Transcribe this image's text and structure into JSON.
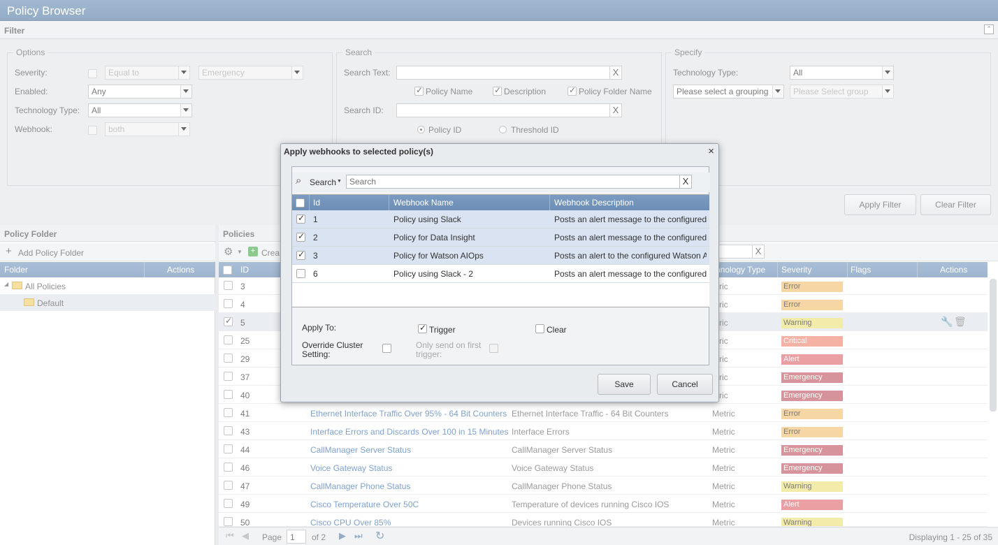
{
  "app": {
    "title": "Policy Browser"
  },
  "filter": {
    "title": "Filter",
    "options": {
      "legend": "Options",
      "severity_label": "Severity:",
      "severity_op": "Equal to",
      "severity_value": "Emergency",
      "enabled_label": "Enabled:",
      "enabled_value": "Any",
      "tech_label": "Technology Type:",
      "tech_value": "All",
      "webhook_label": "Webhook:",
      "webhook_value": "both"
    },
    "search": {
      "legend": "Search",
      "text_label": "Search Text:",
      "policy_name": "Policy Name",
      "description": "Description",
      "policy_folder_name": "Policy Folder Name",
      "id_label": "Search ID:",
      "policy_id": "Policy ID",
      "threshold_id": "Threshold ID",
      "clear_glyph": "X"
    },
    "specify": {
      "legend": "Specify",
      "tech_label": "Technology Type:",
      "tech_value": "All",
      "grouping": "Please select a grouping",
      "group": "Please Select group"
    },
    "apply_button": "Apply Filter",
    "clear_button": "Clear Filter"
  },
  "folder_panel": {
    "title": "Policy Folder",
    "add_label": "Add Policy Folder",
    "col_folder": "Folder",
    "col_actions": "Actions",
    "tree": [
      {
        "label": "All Policies"
      },
      {
        "label": "Default"
      }
    ]
  },
  "policies": {
    "title": "Policies",
    "create_label": "Crea",
    "columns": {
      "id": "ID",
      "tech": "chnology Type",
      "severity": "Severity",
      "flags": "Flags",
      "actions": "Actions"
    },
    "rows": [
      {
        "id": "3",
        "name": "",
        "desc": "",
        "tech": "etric",
        "severity": "Error",
        "checked": false
      },
      {
        "id": "4",
        "name": "",
        "desc": "",
        "tech": "etric",
        "severity": "Error",
        "checked": false
      },
      {
        "id": "5",
        "name": "",
        "desc": "",
        "tech": "etric",
        "severity": "Warning",
        "checked": true
      },
      {
        "id": "25",
        "name": "",
        "desc": "",
        "tech": "etric",
        "severity": "Critical",
        "checked": false
      },
      {
        "id": "29",
        "name": "",
        "desc": "",
        "tech": "etric",
        "severity": "Alert",
        "checked": false
      },
      {
        "id": "37",
        "name": "",
        "desc": "",
        "tech": "etric",
        "severity": "Emergency",
        "checked": false
      },
      {
        "id": "40",
        "name": "",
        "desc": "",
        "tech": "etric",
        "severity": "Emergency",
        "checked": false
      },
      {
        "id": "41",
        "name": "Ethernet Interface Traffic Over 95% - 64 Bit Counters",
        "desc": "Ethernet Interface Traffic - 64 Bit Counters",
        "tech": "Metric",
        "severity": "Error",
        "checked": false
      },
      {
        "id": "43",
        "name": "Interface Errors and Discards Over 100 in 15 Minutes",
        "desc": "Interface Errors",
        "tech": "Metric",
        "severity": "Error",
        "checked": false
      },
      {
        "id": "44",
        "name": "CallManager Server Status",
        "desc": "CallManager Server Status",
        "tech": "Metric",
        "severity": "Emergency",
        "checked": false
      },
      {
        "id": "46",
        "name": "Voice Gateway Status",
        "desc": "Voice Gateway Status",
        "tech": "Metric",
        "severity": "Emergency",
        "checked": false
      },
      {
        "id": "47",
        "name": "CallManager Phone Status",
        "desc": "CallManager Phone Status",
        "tech": "Metric",
        "severity": "Warning",
        "checked": false
      },
      {
        "id": "49",
        "name": "Cisco Temperature Over 50C",
        "desc": "Temperature of devices running Cisco IOS",
        "tech": "Metric",
        "severity": "Alert",
        "checked": false
      },
      {
        "id": "50",
        "name": "Cisco CPU Over 85%",
        "desc": "Devices running Cisco IOS",
        "tech": "Metric",
        "severity": "Warning",
        "checked": false
      }
    ],
    "pager": {
      "page_label": "Page",
      "page": "1",
      "of": "of 2",
      "display": "Displaying 1 - 25 of 35"
    }
  },
  "dialog": {
    "title": "Apply webhooks to selected policy(s)",
    "close_glyph": "×",
    "search_label": "Search",
    "search_placeholder": "Search",
    "clear_glyph": "X",
    "columns": {
      "id": "Id",
      "name": "Webhook Name",
      "desc": "Webhook Description"
    },
    "rows": [
      {
        "id": "1",
        "name": "Policy using Slack",
        "desc": "Posts an alert message to the configured ...",
        "checked": true
      },
      {
        "id": "2",
        "name": "Policy for Data Insight",
        "desc": "Posts an alert message to the configured ...",
        "checked": true
      },
      {
        "id": "3",
        "name": "Policy for Watson AIOps",
        "desc": "Posts an alert to the configured Watson AI...",
        "checked": true
      },
      {
        "id": "6",
        "name": "Policy using Slack - 2",
        "desc": "Posts an alert message to the configured ...",
        "checked": false
      }
    ],
    "apply_to": "Apply To:",
    "trigger": "Trigger",
    "clear": "Clear",
    "override_1": "Override Cluster",
    "override_2": "Setting:",
    "first_1": "Only send on first",
    "first_2": "trigger:",
    "save": "Save",
    "cancel": "Cancel"
  }
}
